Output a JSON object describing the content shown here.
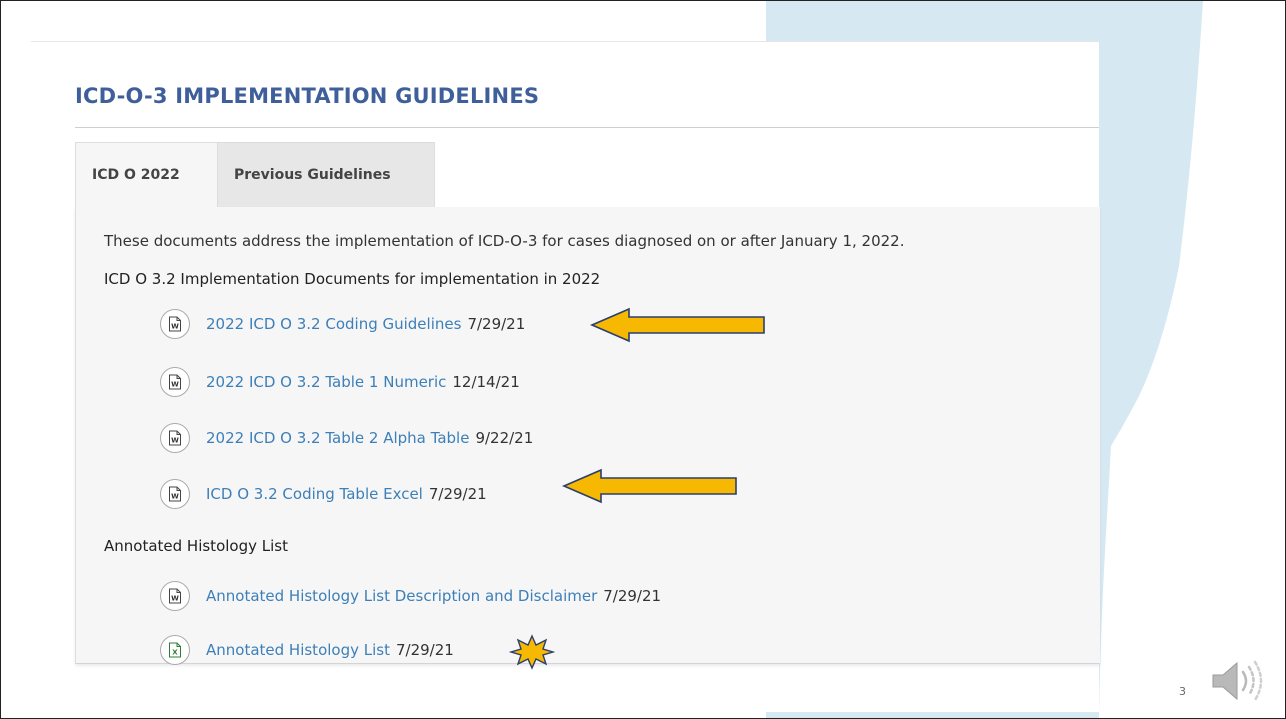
{
  "page": {
    "title": "ICD-O-3 IMPLEMENTATION GUIDELINES",
    "slide_number": "3"
  },
  "tabs": [
    {
      "label": "ICD O 2022",
      "active": true
    },
    {
      "label": "Previous Guidelines",
      "active": false
    }
  ],
  "panel": {
    "intro": "These documents address the implementation of ICD-O-3 for cases diagnosed on or after January 1, 2022.",
    "sections": [
      {
        "heading": "ICD O 3.2 Implementation Documents for implementation in 2022",
        "docs": [
          {
            "link": "2022 ICD O 3.2 Coding Guidelines",
            "date": "7/29/21",
            "icon": "word-document-icon",
            "callout": "arrow"
          },
          {
            "link": "2022 ICD O 3.2 Table 1 Numeric",
            "date": "12/14/21",
            "icon": "word-document-icon",
            "callout": ""
          },
          {
            "link": "2022 ICD O 3.2 Table 2 Alpha Table",
            "date": "9/22/21",
            "icon": "word-document-icon",
            "callout": ""
          },
          {
            "link": "ICD O 3.2 Coding Table Excel",
            "date": "7/29/21",
            "icon": "word-document-icon",
            "callout": "arrow"
          }
        ]
      },
      {
        "heading": "Annotated Histology List",
        "docs": [
          {
            "link": "Annotated Histology List Description and Disclaimer",
            "date": "7/29/21",
            "icon": "word-document-icon",
            "callout": ""
          },
          {
            "link": "Annotated Histology List",
            "date": "7/29/21",
            "icon": "excel-document-icon",
            "callout": "star"
          }
        ]
      }
    ]
  },
  "colors": {
    "title": "#3f5f9b",
    "link": "#3d7fb8",
    "callout_fill": "#f6b800",
    "callout_stroke": "#2a3f6e",
    "ribbon": "#d6e9f2"
  }
}
